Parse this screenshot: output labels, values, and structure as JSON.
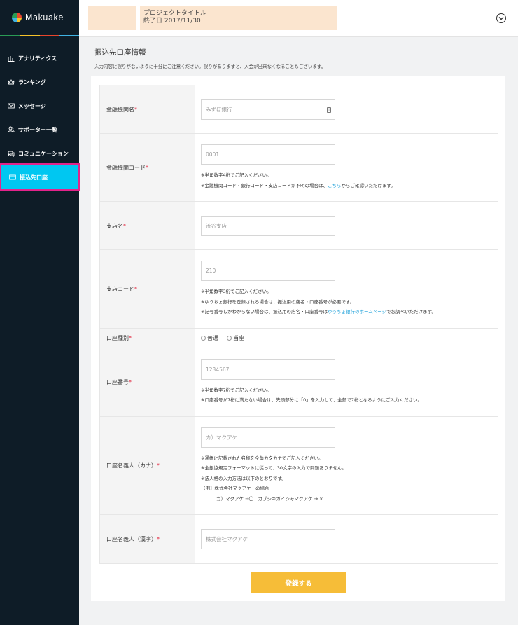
{
  "app": {
    "logo": "Makuake",
    "brand_colors": [
      "#2a9b55",
      "#f5c22a",
      "#e8452c",
      "#3fb3e3"
    ]
  },
  "sidebar": {
    "items": [
      {
        "label": "アナリティクス",
        "icon": "analytics-icon"
      },
      {
        "label": "ランキング",
        "icon": "crown-icon"
      },
      {
        "label": "メッセージ",
        "icon": "mail-icon"
      },
      {
        "label": "サポーター一覧",
        "icon": "users-icon"
      },
      {
        "label": "コミュニケーション",
        "icon": "chat-icon"
      },
      {
        "label": "振込先口座",
        "icon": "card-icon",
        "active": true
      }
    ],
    "active_color": "#00c7f1",
    "highlight_color": "#e2238a"
  },
  "header": {
    "project_title": "プロジェクトタイトル",
    "end_date": "終了日 2017/11/30"
  },
  "main": {
    "title": "振込先口座情報",
    "description": "入力内容に誤りがないように十分にご注意ください。誤りがありますと、入金が出来なくなることもございます。"
  },
  "form": {
    "bank_name": {
      "label": "金融機関名",
      "req": "*",
      "placeholder": "みずほ銀行"
    },
    "bank_code": {
      "label": "金融機関コード",
      "req": "*",
      "placeholder": "0001",
      "note1": "※半角数字4桁でご記入ください。",
      "note2_pre": "※金融機関コード・銀行コード・支店コードが不明の場合は、",
      "note2_link": "こちら",
      "note2_post": "からご確認いただけます。"
    },
    "branch_name": {
      "label": "支店名",
      "req": "*",
      "placeholder": "渋谷支店"
    },
    "branch_code": {
      "label": "支店コード",
      "req": "*",
      "placeholder": "210",
      "note1": "※半角数字3桁でご記入ください。",
      "note2": "※ゆうちょ銀行を登録される場合は、振込用の店名・口座番号が必要です。",
      "note3_pre": "※記号番号しかわからない場合は、振込用の店名・口座番号は",
      "note3_link": "ゆうちょ銀行のホームページ",
      "note3_post": "でお調べいただけます。"
    },
    "account_type": {
      "label": "口座種別",
      "req": "*",
      "option1": "普通",
      "option2": "当座"
    },
    "account_number": {
      "label": "口座番号",
      "req": "*",
      "placeholder": "1234567",
      "note1": "※半角数字7桁でご記入ください。",
      "note2": "※口座番号が7桁に満たない場合は、先頭部分に「0」を入力して、全部で7桁となるようにご入力ください。"
    },
    "holder_kana": {
      "label": "口座名義人（カナ）",
      "req": "*",
      "placeholder": "カ）マクアケ",
      "note1": "※通帳に記載された名称を全角カタカナでご記入ください。",
      "note2": "※全銀協規定フォーマットに従って、30文字の入力で問題ありません。",
      "note3": "※法人格の入力方法は以下のとおりです。",
      "note4": "【例】株式会社マクアケ　の場合",
      "note5": "カ）マクアケ →〇　カブシキガイシャマクアケ → ×"
    },
    "holder_kanji": {
      "label": "口座名義人（漢字）",
      "req": "*",
      "placeholder": "株式会社マクアケ"
    }
  },
  "submit": {
    "label": "登録する",
    "color": "#f6bd38"
  }
}
